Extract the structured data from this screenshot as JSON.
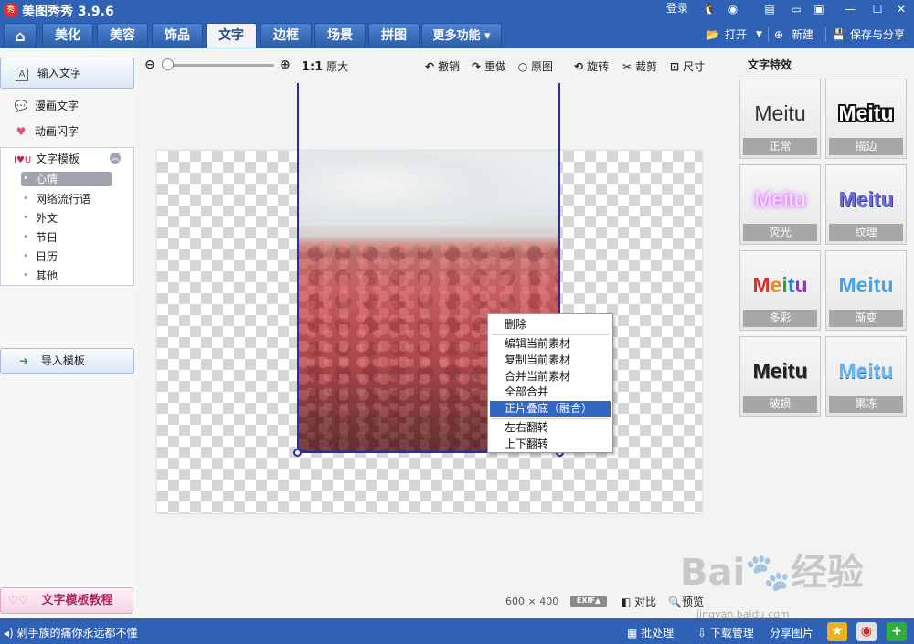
{
  "app": {
    "title": "美图秀秀 3.9.6",
    "logo_text": "秀",
    "login": "登录"
  },
  "window_controls": {
    "minimize": "—",
    "maximize": "☐",
    "close": "✕"
  },
  "tabs": [
    {
      "label": "美化"
    },
    {
      "label": "美容"
    },
    {
      "label": "饰品"
    },
    {
      "label": "文字"
    },
    {
      "label": "边框"
    },
    {
      "label": "场景"
    },
    {
      "label": "拼图"
    },
    {
      "label": "更多功能 ▾"
    }
  ],
  "top_actions": {
    "open": "打开",
    "new": "新建",
    "save_share": "保存与分享"
  },
  "left_panel": {
    "input_text": "输入文字",
    "comic_text": "漫画文字",
    "animated_text": "动画闪字",
    "template_header": "文字模板",
    "templates": [
      "心情",
      "网络流行语",
      "外文",
      "节日",
      "日历",
      "其他"
    ],
    "import_template": "导入模板",
    "tutorial": "文字模板教程"
  },
  "toolbar": {
    "ratio_bold": "1:1",
    "ratio_label": "原大",
    "undo": "撤销",
    "redo": "重做",
    "original": "原图",
    "rotate": "旋转",
    "crop": "裁剪",
    "size": "尺寸"
  },
  "context_menu": {
    "delete": "删除",
    "edit": "编辑当前素材",
    "copy": "复制当前素材",
    "merge": "合并当前素材",
    "merge_all": "全部合并",
    "blend": "正片叠底（融合）",
    "flip_h": "左右翻转",
    "flip_v": "上下翻转"
  },
  "right_panel": {
    "title": "文字特效",
    "sample": "Meitu",
    "effects": [
      "正常",
      "描边",
      "荧光",
      "纹理",
      "多彩",
      "渐变",
      "破损",
      "果冻"
    ]
  },
  "bottom": {
    "size": "600 × 400",
    "exif": "EXIF▲",
    "compare": "对比",
    "preview": "预览"
  },
  "watermark": {
    "brand": "Bai🐾经验",
    "url": "jingyan.baidu.com"
  },
  "statusbar": {
    "marquee": "剁手族的痛你永远都不懂",
    "batch": "批处理",
    "download": "下载管理",
    "share": "分享图片"
  },
  "colors": {
    "chrome_blue": "#2f62b4",
    "menu_highlight": "#3466c4",
    "selection_frame": "#2a2ab0"
  }
}
